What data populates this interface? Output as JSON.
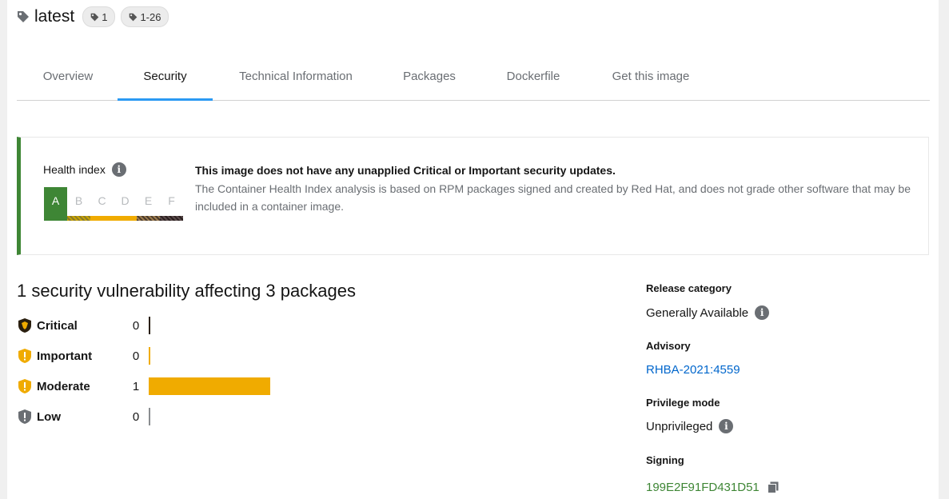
{
  "header": {
    "title": "latest",
    "chips": [
      "1",
      "1-26"
    ]
  },
  "tabs": [
    "Overview",
    "Security",
    "Technical Information",
    "Packages",
    "Dockerfile",
    "Get this image"
  ],
  "active_tab": "Security",
  "health": {
    "label": "Health index",
    "info_glyph": "i",
    "grades": [
      "A",
      "B",
      "C",
      "D",
      "E",
      "F"
    ],
    "current_grade": "A",
    "title": "This image does not have any unapplied Critical or Important security updates.",
    "description": "The Container Health Index analysis is based on RPM packages signed and created by Red Hat, and does not grade other software that may be included in a container image."
  },
  "vulnerabilities": {
    "title": "1 security vulnerability affecting 3 packages",
    "severities": [
      {
        "label": "Critical",
        "count": "0",
        "value": 0,
        "color": "#2a1f0f",
        "icon": "critical-shield-icon"
      },
      {
        "label": "Important",
        "count": "0",
        "value": 0,
        "color": "#f0ab00",
        "icon": "important-shield-icon"
      },
      {
        "label": "Moderate",
        "count": "1",
        "value": 1,
        "color": "#f0ab00",
        "icon": "moderate-shield-icon"
      },
      {
        "label": "Low",
        "count": "0",
        "value": 0,
        "color": "#8a8d90",
        "icon": "low-shield-icon"
      }
    ]
  },
  "meta": {
    "release_category_label": "Release category",
    "release_category_value": "Generally Available",
    "advisory_label": "Advisory",
    "advisory_value": "RHBA-2021:4559",
    "privilege_label": "Privilege mode",
    "privilege_value": "Unprivileged",
    "signing_label": "Signing",
    "signing_value": "199E2F91FD431D51"
  },
  "colors": {
    "accent": "#2b9af3",
    "health_green": "#3e8635",
    "link": "#0066cc",
    "moderate": "#f0ab00"
  }
}
